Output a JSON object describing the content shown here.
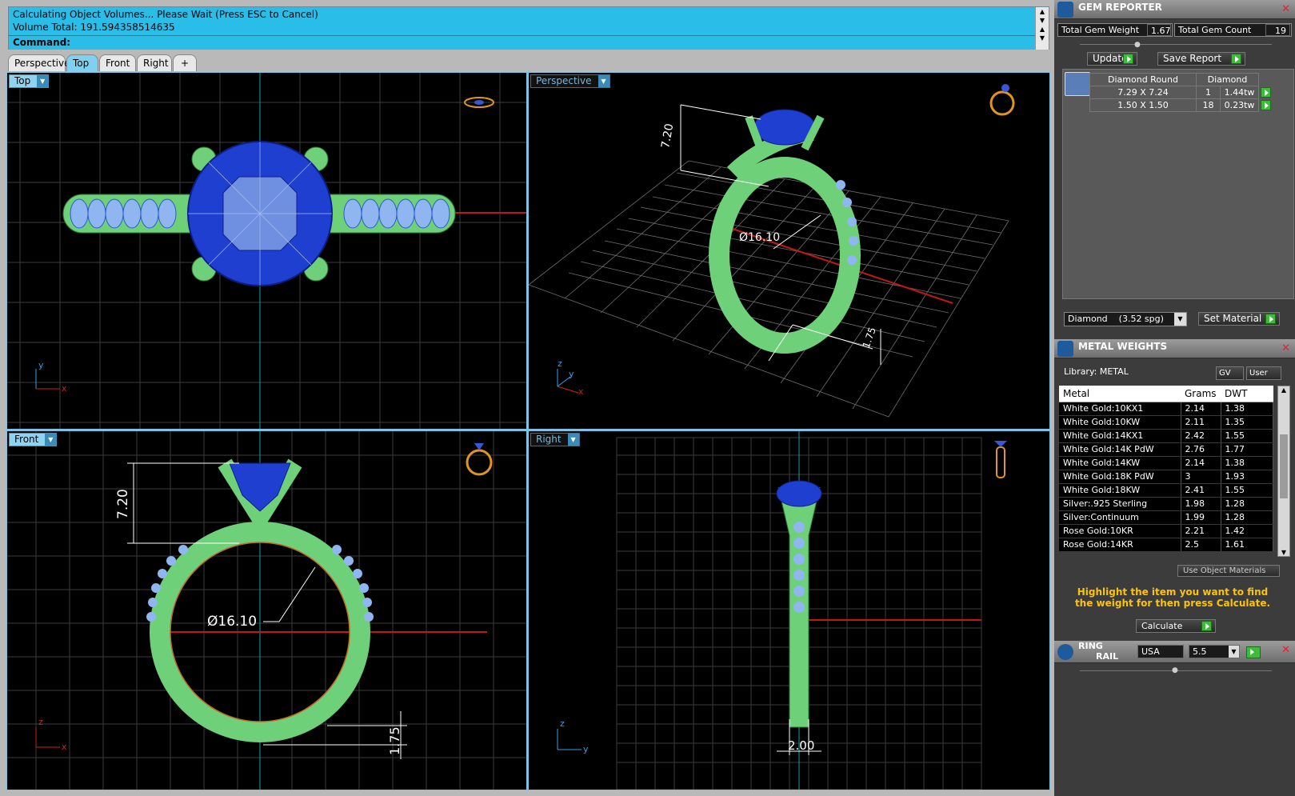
{
  "command": {
    "line1": "Calculating Object Volumes... Please Wait (Press ESC to Cancel)",
    "line2": "Volume Total: 191.594358514635",
    "prompt": "Command:"
  },
  "tabs": [
    "Perspective",
    "Top",
    "Front",
    "Right",
    "+"
  ],
  "active_tab": "Top",
  "viewports": {
    "top": {
      "label": "Top"
    },
    "perspective": {
      "label": "Perspective"
    },
    "front": {
      "label": "Front"
    },
    "right": {
      "label": "Right"
    }
  },
  "dimensions": {
    "height": "7.20",
    "diameter": "Ø16.10",
    "shank": "1.75",
    "width": "2.00"
  },
  "axes": {
    "x": "x",
    "y": "y",
    "z": "z"
  },
  "gem_reporter": {
    "title": "GEM REPORTER",
    "total_weight_label": "Total Gem Weight",
    "total_weight": "1.67",
    "total_count_label": "Total Gem Count",
    "total_count": "19",
    "update_label": "Update",
    "save_label": "Save Report",
    "table_header": [
      "Diamond Round",
      "Diamond"
    ],
    "rows": [
      {
        "size": "7.29 X 7.24",
        "count": "1",
        "weight": "1.44tw"
      },
      {
        "size": "1.50 X 1.50",
        "count": "18",
        "weight": "0.23tw"
      }
    ],
    "material": "Diamond    (3.52 spg)",
    "set_material_label": "Set Material"
  },
  "metal_weights": {
    "title": "METAL WEIGHTS",
    "library_label": "Library:  METAL",
    "gv_label": "GV",
    "user_label": "User",
    "columns": [
      "Metal",
      "Grams",
      "DWT"
    ],
    "rows": [
      [
        "White Gold:10KX1",
        "2.14",
        "1.38"
      ],
      [
        "White Gold:10KW",
        "2.11",
        "1.35"
      ],
      [
        "White Gold:14KX1",
        "2.42",
        "1.55"
      ],
      [
        "White Gold:14K PdW",
        "2.76",
        "1.77"
      ],
      [
        "White Gold:14KW",
        "2.14",
        "1.38"
      ],
      [
        "White Gold:18K PdW",
        "3",
        "1.93"
      ],
      [
        "White Gold:18KW",
        "2.41",
        "1.55"
      ],
      [
        "Silver:.925 Sterling",
        "1.98",
        "1.28"
      ],
      [
        "Silver:Continuum",
        "1.99",
        "1.28"
      ],
      [
        "Rose Gold:10KR",
        "2.21",
        "1.42"
      ],
      [
        "Rose Gold:14KR",
        "2.5",
        "1.61"
      ]
    ],
    "use_object_materials": "Use Object Materials",
    "hint": "Highlight the item you want to find the weight for then press Calculate.",
    "calculate_label": "Calculate"
  },
  "ring_rail": {
    "title_line1": "RING",
    "title_line2": "RAIL",
    "country": "USA",
    "size": "5.5"
  },
  "colors": {
    "cyan_bar": "#29bde7",
    "metal_green": "#6fd07a",
    "gem_blue": "#1f3fd0",
    "highlight_yellow": "#ffc400"
  }
}
